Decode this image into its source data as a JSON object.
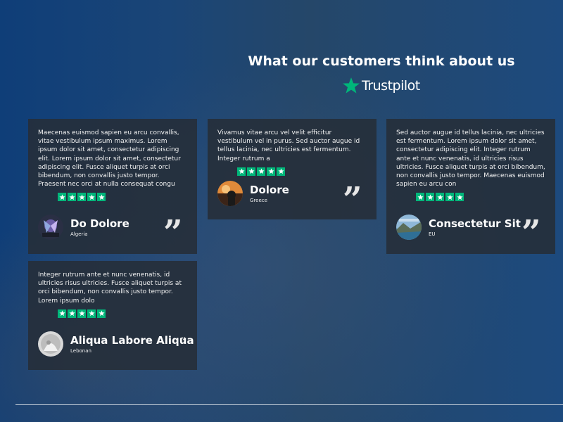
{
  "header": {
    "title": "What our customers think about us",
    "brand": "Trustpilot",
    "brand_star_color": "#00b67a"
  },
  "rating_star_color": "#00b67a",
  "testimonials": [
    {
      "text": "Maecenas euismod sapien eu arcu convallis, vitae vestibulum ipsum maximus. Lorem ipsum dolor sit amet, consectetur adipiscing elit. Lorem ipsum dolor sit amet, consectetur adipiscing elit. Fusce aliquet turpis at orci bibendum, non convallis justo tempor. Praesent nec orci at nulla consequat congu",
      "stars": 5,
      "name": "Do Dolore",
      "location": "Algeria"
    },
    {
      "text": "Vivamus vitae arcu vel velit efficitur vestibulum vel in purus. Sed auctor augue id tellus lacinia, nec ultricies est fermentum. Integer rutrum a",
      "stars": 5,
      "name": "Dolore",
      "location": "Greece"
    },
    {
      "text": "Sed auctor augue id tellus lacinia, nec ultricies est fermentum. Lorem ipsum dolor sit amet, consectetur adipiscing elit. Integer rutrum ante et nunc venenatis, id ultricies risus ultricies. Fusce aliquet turpis at orci bibendum, non convallis justo tempor. Maecenas euismod sapien eu arcu con",
      "stars": 5,
      "name": "Consectetur Sit",
      "location": "EU"
    },
    {
      "text": "Integer rutrum ante et nunc venenatis, id ultricies risus ultricies. Fusce aliquet turpis at orci bibendum, non convallis justo tempor. Lorem ipsum dolo",
      "stars": 5,
      "name": "Aliqua Labore Aliqua",
      "location": "Lebonan"
    }
  ]
}
